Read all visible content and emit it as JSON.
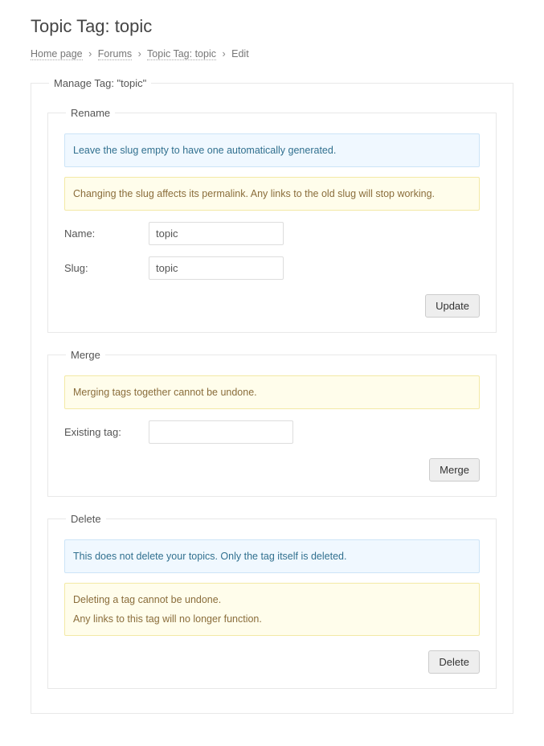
{
  "page": {
    "title": "Topic Tag: topic"
  },
  "breadcrumb": {
    "home": "Home page",
    "forums": "Forums",
    "tag": "Topic Tag: topic",
    "edit": "Edit",
    "sep": "›"
  },
  "manage": {
    "legend": "Manage Tag: \"topic\""
  },
  "rename": {
    "legend": "Rename",
    "info": "Leave the slug empty to have one automatically generated.",
    "warn": "Changing the slug affects its permalink. Any links to the old slug will stop working.",
    "name_label": "Name:",
    "name_value": "topic",
    "slug_label": "Slug:",
    "slug_value": "topic",
    "button": "Update"
  },
  "merge": {
    "legend": "Merge",
    "warn": "Merging tags together cannot be undone.",
    "existing_label": "Existing tag:",
    "existing_value": "",
    "button": "Merge"
  },
  "delete": {
    "legend": "Delete",
    "info": "This does not delete your topics. Only the tag itself is deleted.",
    "warn1": "Deleting a tag cannot be undone.",
    "warn2": "Any links to this tag will no longer function.",
    "button": "Delete"
  }
}
